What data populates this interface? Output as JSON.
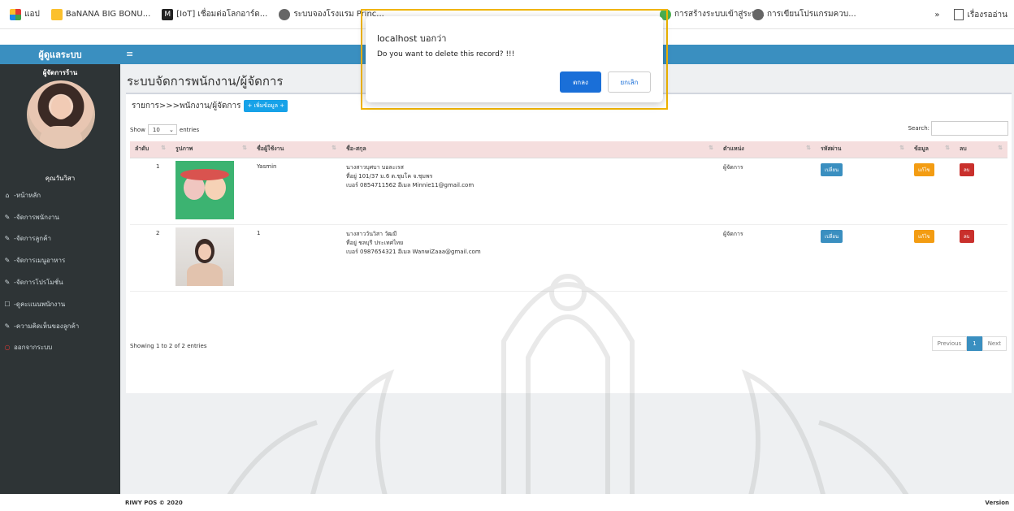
{
  "bookmarks": [
    {
      "label": "แอป",
      "icon": "apps-grid-icon",
      "color": "#e53935"
    },
    {
      "label": "BaNANA BIG BONU...",
      "icon": "banana-icon",
      "color": "#fbc02d"
    },
    {
      "label": "[IoT] เชื่อมต่อโลกอาร์ด...",
      "icon": "m-logo-icon",
      "color": "#222222"
    },
    {
      "label": "ระบบจองโรงแรม Princ...",
      "icon": "globe-icon",
      "color": "#555555"
    },
    {
      "label": "การสร้างระบบเข้าสู่ระบ...",
      "icon": "globe-icon",
      "color": "#555555"
    },
    {
      "label": "การเขียนโปรแกรมควบ...",
      "icon": "globe-icon",
      "color": "#555555"
    }
  ],
  "bookmarks_more": "»",
  "reading_list": "เรื่องรออ่าน",
  "brand": "ผู้ดูแลระบบ",
  "sidebar": {
    "role": "ผู้จัดการร้าน",
    "name": "คุณวันวิสา",
    "items": [
      {
        "label": "-หน้าหลัก",
        "icon": "home-icon"
      },
      {
        "label": "-จัดการพนักงาน",
        "icon": "edit-icon"
      },
      {
        "label": "-จัดการลูกค้า",
        "icon": "edit-icon"
      },
      {
        "label": "-จัดการเมนูอาหาร",
        "icon": "edit-icon"
      },
      {
        "label": "-จัดการโปรโมชั่น",
        "icon": "edit-icon"
      },
      {
        "label": "-ดูคะแนนพนักงาน",
        "icon": "checkbox-icon"
      },
      {
        "label": "-ความคิดเห็นของลูกค้า",
        "icon": "edit-icon"
      },
      {
        "label": "ออกจากระบบ",
        "icon": "power-icon"
      }
    ]
  },
  "main": {
    "title": "ระบบจัดการพนักงาน/ผู้จัดการ",
    "breadcrumb": "รายการ>>>พนักงาน/ผู้จัดการ",
    "add_button": "+ เพิ่มข้อมูล +",
    "show_label": "Show",
    "show_value": "10",
    "entries_label": "entries",
    "search_label": "Search:",
    "columns": [
      "ลำดับ",
      "รูปภาพ",
      "ชื่อผู้ใช้งาน",
      "ชื่อ-สกุล",
      "ตำแหน่ง",
      "รหัสผ่าน",
      "ข้อมูล",
      "ลบ"
    ],
    "rows": [
      {
        "no": "1",
        "username": "Yasmin",
        "name_line1": "นางสาวบุศบา บอละเรส",
        "name_line2": "ที่อยู่ 101/37 ม.6 ต.ชุมโค จ.ชุมพร",
        "name_line3": "เบอร์ 0854711562 อีเมล Minnie11@gmail.com",
        "position": "ผู้จัดการ",
        "pw_button": "เปลี่ยน",
        "edit_button": "แก้ไข",
        "delete_button": "ลบ"
      },
      {
        "no": "2",
        "username": "1",
        "name_line1": "นางสาววันวิสา วัฒมี",
        "name_line2": "ที่อยู่ ชลบุรี ประเทศไทย",
        "name_line3": "เบอร์ 0987654321 อีเมล WanwiZaaa@gmail.com",
        "position": "ผู้จัดการ",
        "pw_button": "เปลี่ยน",
        "edit_button": "แก้ไข",
        "delete_button": "ลบ"
      }
    ],
    "info": "Showing 1 to 2 of 2 entries",
    "pager": [
      "Previous",
      "1",
      "Next"
    ]
  },
  "footer": {
    "left": "RIWY POS © 2020",
    "right": "Version"
  },
  "dialog": {
    "title": "localhost บอกว่า",
    "message": "Do you want to delete this record? !!!",
    "ok": "ตกลง",
    "cancel": "ยกเลิก"
  }
}
